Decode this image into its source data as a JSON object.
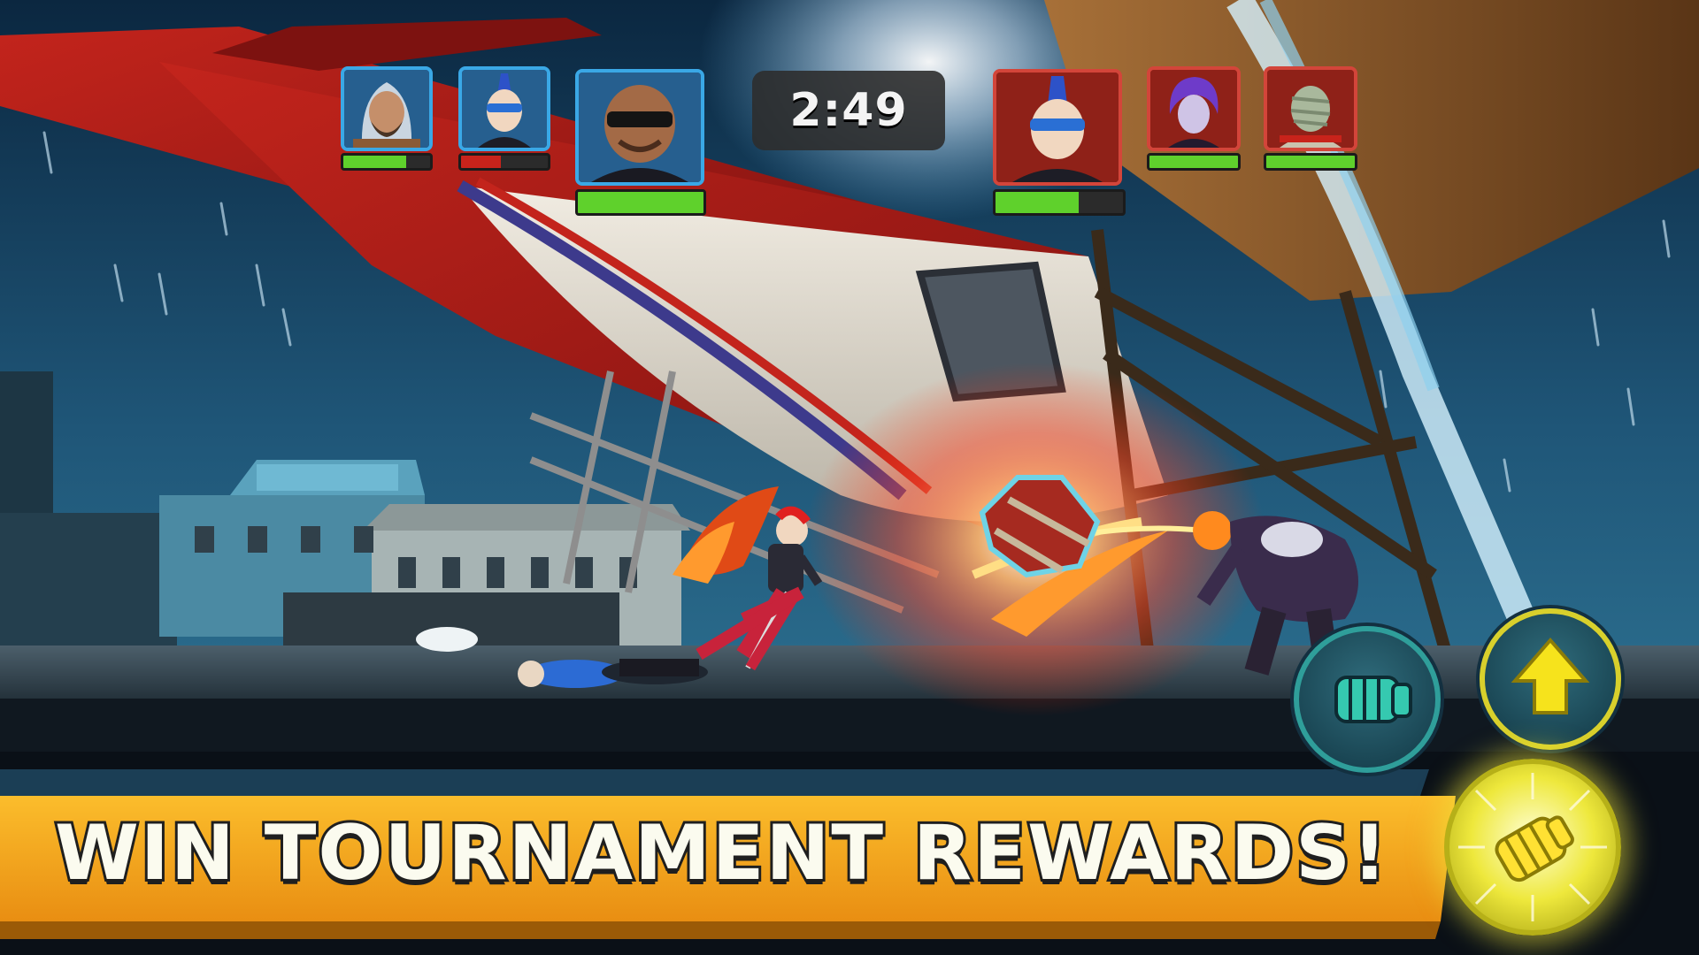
{
  "hud": {
    "timer": "2:49",
    "team_left": [
      {
        "name_icon": "hooded-desert-fighter-portrait",
        "hp": 0.72
      },
      {
        "name_icon": "punk-goggles-fighter-portrait",
        "hp": 0.46
      },
      {
        "name_icon": "bald-sunglasses-brawler-portrait",
        "hp": 1.0
      }
    ],
    "team_right": [
      {
        "name_icon": "punk-goggles-fighter-portrait",
        "hp": 0.65
      },
      {
        "name_icon": "purple-hair-fighter-portrait",
        "hp": 1.0
      },
      {
        "name_icon": "bandaged-mummy-fighter-portrait",
        "hp": 1.0
      }
    ]
  },
  "controls": {
    "punch_icon": "fist-icon",
    "jump_icon": "up-arrow-icon",
    "special_icon": "power-fist-icon"
  },
  "banner": {
    "text": "WIN TOURNAMENT REWARDS!"
  },
  "colors": {
    "hp_green": "#5fd12c",
    "hp_red": "#c8231b",
    "team_blue": "#3aa8e6",
    "team_red": "#d3453a",
    "banner_orange": "#f7a21a",
    "special_yellow": "#e6dd2a",
    "jump_arrow_yellow": "#f6e31c",
    "punch_teal": "#35c9b0"
  }
}
